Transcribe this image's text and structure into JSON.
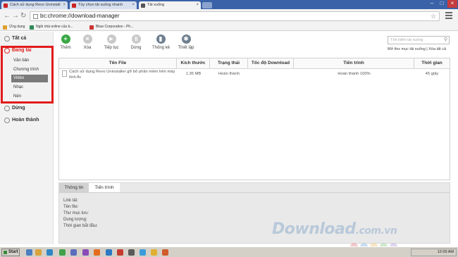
{
  "browser": {
    "tabs": [
      {
        "label": "Cách sử dụng Revo Uninstall",
        "favicon_color": "#cc2222"
      },
      {
        "label": "Tùy chọn tải xuống nhanh",
        "favicon_color": "#cc2222"
      },
      {
        "label": "Tải xuống",
        "favicon_color": "#555555"
      }
    ],
    "address": "bc:chrome://download-manager",
    "bookmarks": [
      {
        "label": "Ứng dụng",
        "icon_color": "#e0a030"
      },
      {
        "label": "Ngồi nhà online của b...",
        "icon_color": "#2e8b57"
      },
      {
        "label": "Bkav Corporation - Ph...",
        "icon_color": "#cc3333"
      }
    ]
  },
  "sidebar": {
    "all": "Tất cả",
    "downloading": "Đang tải",
    "categories": [
      "Văn bản",
      "Chương trình",
      "Video",
      "Nhạc",
      "Nén"
    ],
    "selected_category": "Video",
    "stopped": "Dừng",
    "completed": "Hoàn thành"
  },
  "actions": [
    {
      "label": "Thêm",
      "icon": "plus-icon",
      "color": "#3aa845"
    },
    {
      "label": "Xóa",
      "icon": "close-icon",
      "color": "#c4c4c4"
    },
    {
      "label": "Tiếp tục",
      "icon": "play-icon",
      "color": "#c4c4c4"
    },
    {
      "label": "Dừng",
      "icon": "pause-icon",
      "color": "#c4c4c4"
    },
    {
      "label": "Thống kê",
      "icon": "stats-icon",
      "color": "#6e7f8f"
    },
    {
      "label": "Thiết lập",
      "icon": "gear-icon",
      "color": "#6e7f8f"
    }
  ],
  "search": {
    "placeholder": "Tìm kiếm tải xuống"
  },
  "links": {
    "open_folder": "Mở thư mục tải xuống",
    "clear_all": "Xóa tất cả"
  },
  "table": {
    "headers": [
      "Tên File",
      "Kích thước",
      "Trạng thái",
      "Tốc độ Download",
      "Tiến trình",
      "Thời gian"
    ],
    "rows": [
      {
        "file_name": "Cách sử dụng Revo Uninstaller gỡ bỏ phần mềm trên máy tính.flv",
        "size": "1.36 MB",
        "status": "Hoàn thành",
        "speed": "",
        "progress": "Hoàn thành 100%",
        "time": "45 giây"
      }
    ]
  },
  "details": {
    "tabs": [
      "Thông tin",
      "Tiến trình"
    ],
    "fields": [
      "Link tải:",
      "Tên file:",
      "Thư mục lưu:",
      "Dung lượng:",
      "Thời gian bắt đầu:"
    ]
  },
  "watermark": {
    "brand": "Download",
    "domain": ".com.vn"
  },
  "taskbar": {
    "start": "Start",
    "clock": "12:09 AM"
  }
}
